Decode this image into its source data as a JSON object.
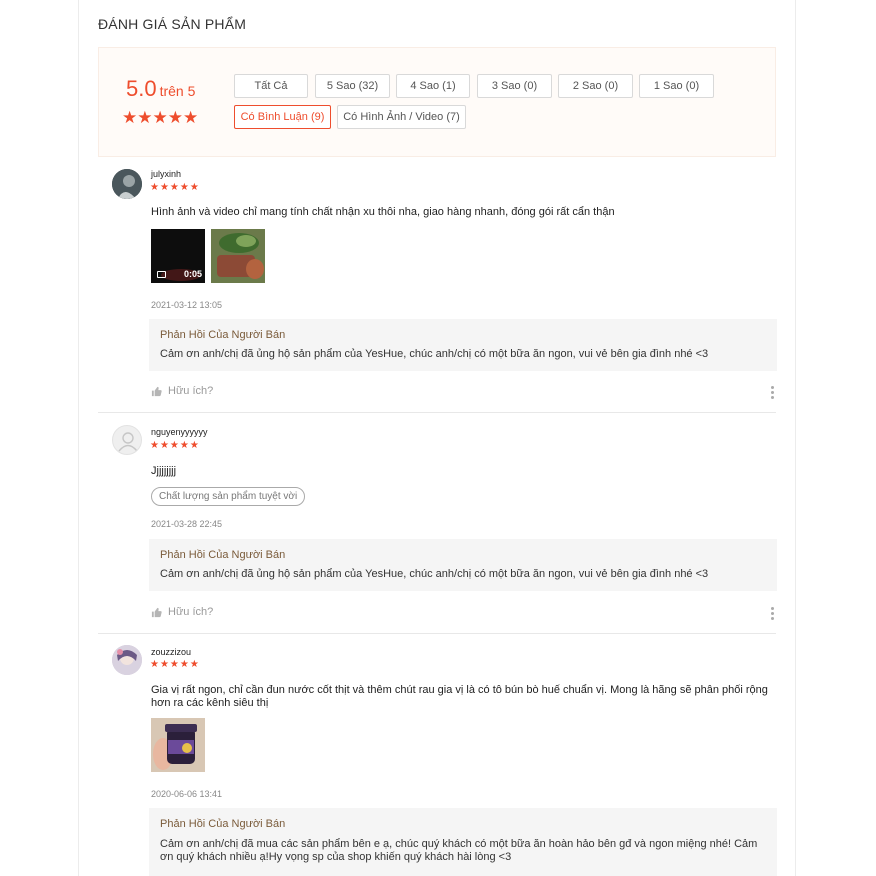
{
  "section_title": "ĐÁNH GIÁ SẢN PHẨM",
  "overview": {
    "score": "5.0",
    "score_suffix": "trên 5",
    "stars": "★★★★★",
    "filters": [
      {
        "label": "Tất Cả"
      },
      {
        "label": "5 Sao (32)"
      },
      {
        "label": "4 Sao (1)"
      },
      {
        "label": "3 Sao (0)"
      },
      {
        "label": "2 Sao (0)"
      },
      {
        "label": "1 Sao (0)"
      },
      {
        "label": "Có Bình Luận (9)"
      },
      {
        "label": "Có Hình Ảnh / Video (7)"
      }
    ],
    "active_filter": "Có Bình Luận (9)"
  },
  "reviews": [
    {
      "username": "julyxinh",
      "stars": "★★★★★",
      "comment": "Hình ảnh và video chỉ mang tính chất nhận xu thôi nha, giao hàng nhanh, đóng gói rất cẩn thận",
      "video_duration": "0:05",
      "date": "2021-03-12 13:05",
      "reply_title": "Phản Hồi Của Người Bán",
      "reply_text": "Cảm ơn anh/chị đã ủng hộ sản phẩm của YesHue, chúc anh/chị có một bữa ăn ngon, vui vẻ bên gia đình nhé <3",
      "helpful": "Hữu ích?"
    },
    {
      "username": "nguyenyyyyyy",
      "stars": "★★★★★",
      "comment": "Jjjjjjjjj",
      "tag": "Chất lượng sản phẩm tuyệt vời",
      "date": "2021-03-28 22:45",
      "reply_title": "Phản Hồi Của Người Bán",
      "reply_text": "Cảm ơn anh/chị đã ủng hộ sản phẩm của YesHue, chúc anh/chị có một bữa ăn ngon, vui vẻ bên gia đình nhé <3",
      "helpful": "Hữu ích?"
    },
    {
      "username": "zouzzizou",
      "stars": "★★★★★",
      "comment": "Gia vị rất ngon, chỉ cần đun nước cốt thịt và thêm chút rau gia vị là có tô bún bò huế chuẩn vị. Mong là hãng sẽ phân phối rộng hơn ra các kênh siêu thị",
      "date": "2020-06-06 13:41",
      "reply_title": "Phản Hồi Của Người Bán",
      "reply_text": "Cảm ơn anh/chị đã mua các sản phẩm bên e ạ, chúc quý khách có một bữa ăn hoàn hảo bên gđ và ngon miệng nhé! Cảm ơn quý khách nhiều ạ!Hy vọng sp của shop khiến quý khách hài lòng <3"
    }
  ],
  "colors": {
    "accent": "#ee4d2d",
    "overview_bg": "#fffbf8",
    "reply_bg": "#f5f5f5",
    "reply_title": "#7a5b3a"
  },
  "icons": {
    "thumbs_up": "thumbs-up-icon",
    "more": "more-vertical-icon",
    "default_avatar": "user-silhouette-icon",
    "video": "video-camera-icon"
  }
}
